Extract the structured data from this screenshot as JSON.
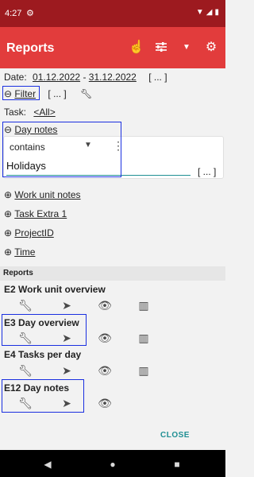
{
  "status_bar": {
    "time": "4:27"
  },
  "app_bar": {
    "title": "Reports",
    "icons": [
      "touch-icon",
      "filter-sliders-icon",
      "dropdown-icon",
      "settings-icon"
    ]
  },
  "filters": {
    "date_label": "Date:",
    "date_from": "01.12.2022",
    "date_separator": "-",
    "date_to": "31.12.2022",
    "date_more": "[ ... ]",
    "filter_label": "Filter",
    "filter_more": "[ ... ]",
    "task_label": "Task:",
    "task_value": "<All>",
    "day_notes": {
      "label": "Day notes",
      "operator": "contains",
      "value": "Holidays",
      "more": "[ ... ]"
    },
    "collapsed": [
      "Work unit notes",
      "Task Extra 1",
      "ProjectID",
      "Time"
    ]
  },
  "reports": {
    "header": "Reports",
    "items": [
      {
        "title": "E2 Work unit overview"
      },
      {
        "title": "E3 Day overview"
      },
      {
        "title": "E4 Tasks per day"
      },
      {
        "title": "E12 Day notes"
      }
    ]
  },
  "dialog": {
    "close_label": "CLOSE"
  },
  "colors": {
    "status_bar": "#9d1a1f",
    "app_bar": "#e23c3c",
    "accent": "#1f8f93",
    "highlight": "#1a2fe0"
  }
}
